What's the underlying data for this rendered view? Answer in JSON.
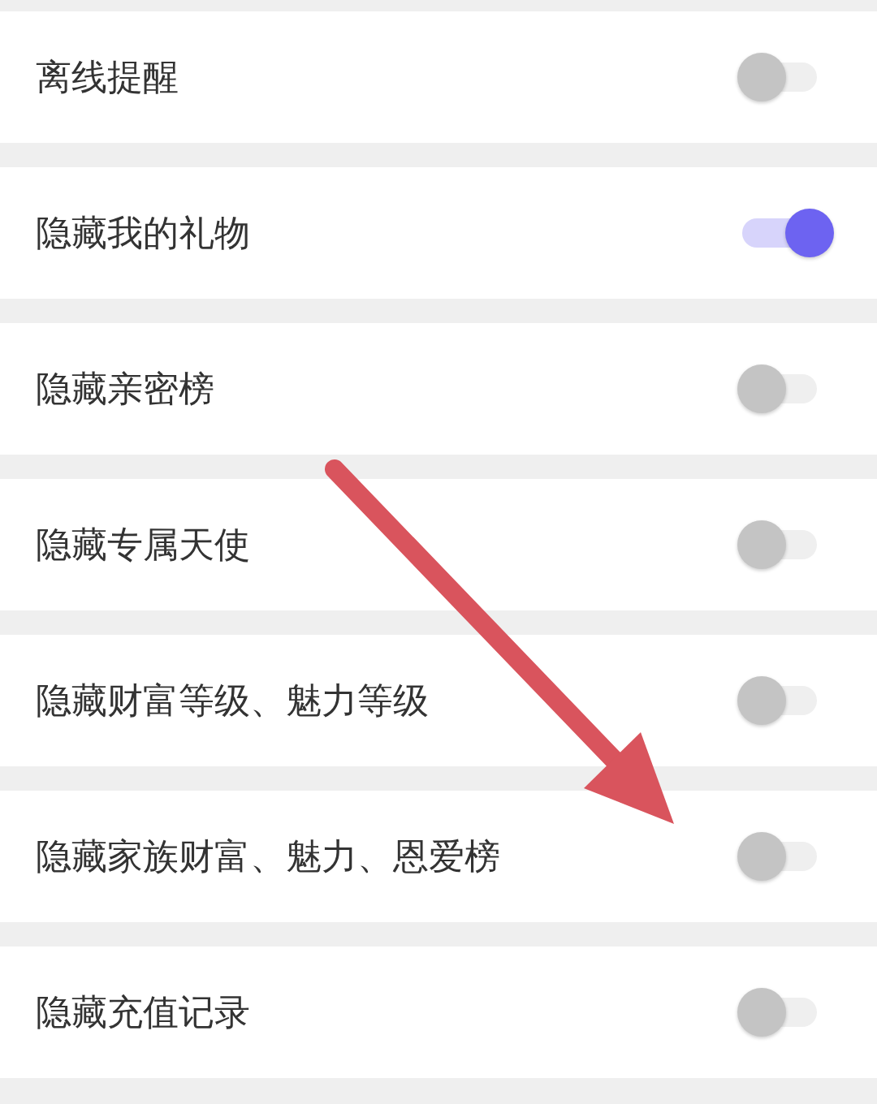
{
  "settings": [
    {
      "label": "离线提醒",
      "on": false
    },
    {
      "label": "隐藏我的礼物",
      "on": true
    },
    {
      "label": "隐藏亲密榜",
      "on": false
    },
    {
      "label": "隐藏专属天使",
      "on": false
    },
    {
      "label": "隐藏财富等级、魅力等级",
      "on": false
    },
    {
      "label": "隐藏家族财富、魅力、恩爱榜",
      "on": false
    },
    {
      "label": "隐藏充值记录",
      "on": false
    }
  ]
}
